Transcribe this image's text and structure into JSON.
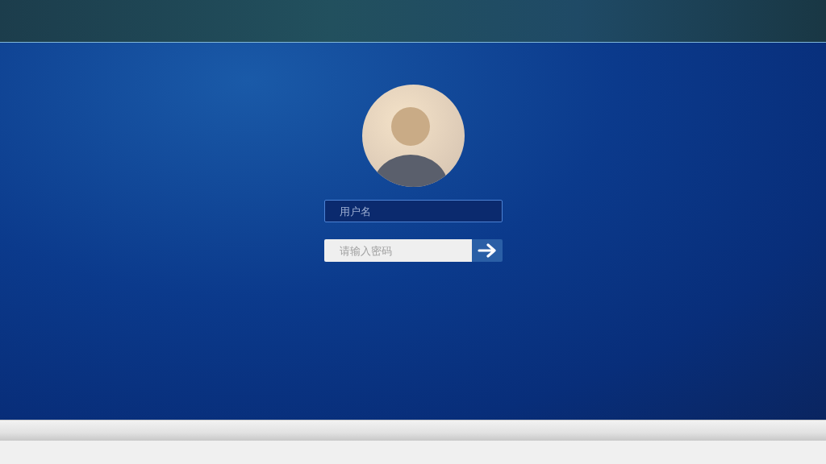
{
  "login": {
    "username_field": {
      "placeholder": "用户名"
    },
    "password_field": {
      "placeholder": "请输入密码"
    }
  }
}
